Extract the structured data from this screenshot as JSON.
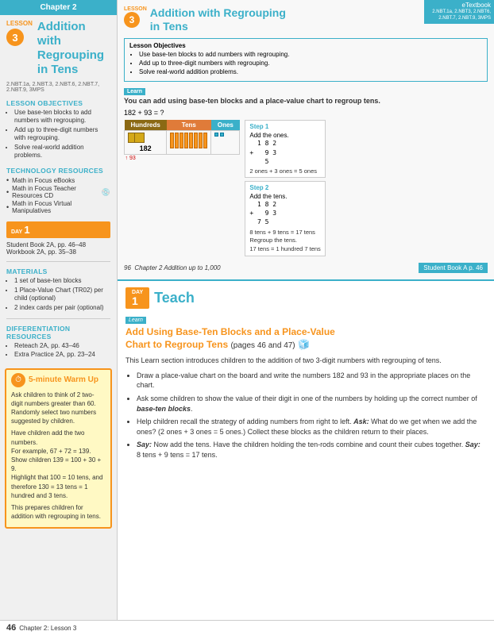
{
  "sidebar": {
    "chapter_header": "Chapter 2",
    "lesson_label": "LESSON",
    "lesson_number": "3",
    "lesson_title_line1": "Addition with",
    "lesson_title_line2": "Regrouping in Tens",
    "common_core": "2.NBT.1a, 2.NBT.3, 2.NBT.6, 2.NBT.7, 2.NBT.9, 3MPS",
    "lesson_objectives_title": "LESSON OBJECTIVES",
    "lesson_objectives": [
      "Use base-ten blocks to add numbers with regrouping.",
      "Add up to three-digit numbers with regrouping.",
      "Solve real-world addition problems."
    ],
    "tech_resources_title": "TECHNOLOGY RESOURCES",
    "tech_resources": [
      "Math in Focus eBooks",
      "Math in Focus Teacher Resources CD",
      "Math in Focus Virtual Manipulatives"
    ],
    "day_label": "DAY",
    "day_number": "1",
    "day_items": [
      "Student Book 2A, pp. 46–48",
      "Workbook 2A, pp. 35–38"
    ],
    "materials_title": "MATERIALS",
    "materials": [
      "1 set of base-ten blocks",
      "1 Place-Value Chart (TR02) per child (optional)",
      "2 index cards per pair (optional)"
    ],
    "diff_resources_title": "DIFFERENTIATION RESOURCES",
    "diff_resources": [
      "Reteach 2A, pp. 43–46",
      "Extra Practice 2A, pp. 23–24"
    ],
    "warm_up_title": "5-minute Warm Up",
    "warm_up_bullets": [
      "Ask children to think of 2 two-digit numbers greater than 60. Randomly select two numbers suggested by children.",
      "Have children add the two numbers.\nFor example, 67 + 72 = 139.\nShow children 139 = 100 + 30 + 9.\nHighlight that 100 = 10 tens, and therefore 130 = 13 tens = 1 hundred and 3 tens.",
      "This prepares children for addition with regrouping in tens."
    ]
  },
  "footer": {
    "page_number": "46",
    "text": "Chapter 2: Lesson 3"
  },
  "textbook": {
    "standard": "2.NBT.1a, 2.NBT3, 2.NBT6, 2.NBT.7, 2.NBT.9, 3MPS",
    "lesson_number": "3",
    "lesson_title": "Addition with Regrouping\nin Tens",
    "objectives_title": "Lesson Objectives",
    "objectives": [
      "Use base-ten blocks to add numbers with regrouping.",
      "Add up to three-digit numbers with regrouping.",
      "Solve real-world addition problems."
    ],
    "learn_label": "Learn",
    "learn_description": "You can add using base-ten blocks and a place-value chart to regroup tens.",
    "equation": "182 + 93 = ?",
    "place_value_headers": [
      "Hundreds",
      "Tens",
      "Ones"
    ],
    "step1_title": "Step 1",
    "step1_desc": "Add the ones.",
    "step1_problem": "  1 8 2\n+   9 3\n    5",
    "step1_note": "2 ones + 3 ones = 5 ones",
    "step2_title": "Step 2",
    "step2_desc": "Add the tens.",
    "step2_problem": "  1 8 2\n+   9 3\n  7 5",
    "step2_note": "8 tens + 9 tens = 17 tens\nRegroup the tens.\n17 tens = 1 hundred 7 tens",
    "page_number": "96",
    "chapter_ref": "Chapter 2  Addition up to 1,000",
    "student_book_ref": "Student Book A  p. 46"
  },
  "teach": {
    "day_label": "DAY",
    "day_number": "1",
    "teach_title": "Teach",
    "learn_tag": "Learn",
    "section_title": "Add Using Base-Ten Blocks and a Place-Value\nChart to Regroup Tens",
    "pages_ref": "(pages 46 and 47)",
    "intro_text": "This Learn section introduces children to the addition of two 3-digit numbers with regrouping of tens.",
    "bullets": [
      "Draw a place-value chart on the board and write the numbers 182 and 93 in the appropriate places on the chart.",
      "Ask some children to show the value of their digit in one of the numbers by holding up the correct number of base-ten blocks.",
      "Help children recall the strategy of adding numbers from right to left. Ask: What do we get when we add the ones? (2 ones + 3 ones = 5 ones.) Collect these blocks as the children return to their places.",
      "Say: Now add the tens. Have the children holding the ten-rods combine and count their cubes together. Say: 8 tens + 9 tens = 17 tens."
    ]
  }
}
